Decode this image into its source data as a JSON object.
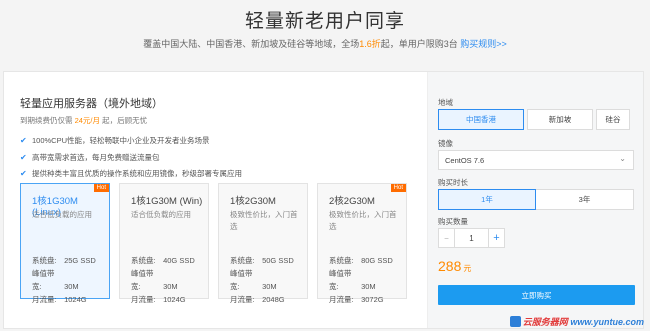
{
  "header": {
    "title": "轻量新老用户同享",
    "subtitle_prefix": "覆盖中国大陆、中国香港、新加坡及硅谷等地域，全场",
    "subtitle_discount": "1.6折",
    "subtitle_mid": "起，单用户限购3台",
    "subtitle_link": "购买规则>>"
  },
  "product": {
    "title": "轻量应用服务器（境外地域）",
    "promo_prefix": "到期续费仍仅需",
    "promo_price": "24元/月",
    "promo_suffix": "起，后顾无忧",
    "features": [
      "100%CPU性能，轻松畅联中小企业及开发者业务场景",
      "高带宽需求首选，每月免费赠送流量包",
      "提供种类丰富且优质的操作系统和应用镜像，秒级部署专属应用"
    ]
  },
  "plans": [
    {
      "name": "1核1G30M (Linux)",
      "desc": "适合低负载的应用",
      "hot": "Hot",
      "disk_label": "系统盘:",
      "disk": "25G SSD",
      "bw_label": "峰值带宽:",
      "bw": "30M",
      "traffic_label": "月流量:",
      "traffic": "1024G"
    },
    {
      "name": "1核1G30M (Win)",
      "desc": "适合低负载的应用",
      "hot": "",
      "disk_label": "系统盘:",
      "disk": "40G SSD",
      "bw_label": "峰值带宽:",
      "bw": "30M",
      "traffic_label": "月流量:",
      "traffic": "1024G"
    },
    {
      "name": "1核2G30M",
      "desc": "极致性价比，入门首选",
      "hot": "",
      "disk_label": "系统盘:",
      "disk": "50G SSD",
      "bw_label": "峰值带宽:",
      "bw": "30M",
      "traffic_label": "月流量:",
      "traffic": "2048G"
    },
    {
      "name": "2核2G30M",
      "desc": "极致性价比，入门首选",
      "hot": "Hot",
      "disk_label": "系统盘:",
      "disk": "80G SSD",
      "bw_label": "峰值带宽:",
      "bw": "30M",
      "traffic_label": "月流量:",
      "traffic": "3072G"
    }
  ],
  "config": {
    "region_label": "地域",
    "regions": [
      "中国香港",
      "新加坡",
      "硅谷"
    ],
    "image_label": "镜像",
    "image_value": "CentOS 7.6",
    "duration_label": "购买时长",
    "durations": [
      "1年",
      "3年"
    ],
    "qty_label": "购买数量",
    "minus": "−",
    "qty": "1",
    "plus": "+",
    "price": "288",
    "price_unit": "元",
    "buy_label": "立即购买"
  },
  "watermark": {
    "part1": "云服务器网",
    "part2": "www.yuntue.com"
  },
  "colors": {
    "accent": "#2d8cf0",
    "orange": "#ff8a00",
    "button": "#1c9bf0"
  }
}
